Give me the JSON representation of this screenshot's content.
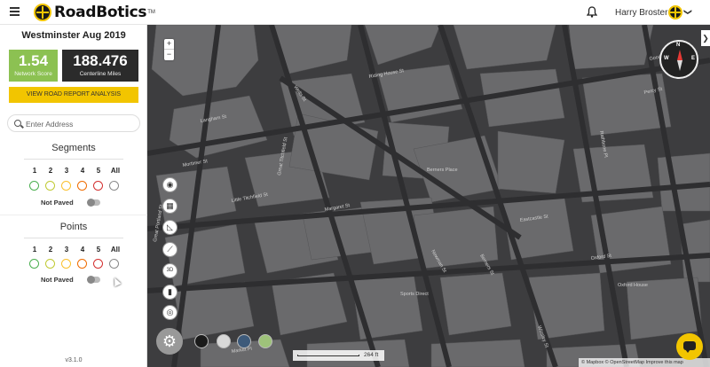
{
  "header": {
    "logo_text": "RoadBotics",
    "logo_tm": "TM",
    "user_name": "Harry Broster",
    "user_chevron": "❯"
  },
  "sidebar": {
    "project_title": "Westminster Aug 2019",
    "network_score": {
      "value": "1.54",
      "label": "Network Score",
      "color": "#8cc152"
    },
    "centerline": {
      "value": "188.476",
      "label": "Centerline Miles"
    },
    "report_button": "VIEW ROAD REPORT ANALYSIS",
    "search_placeholder": "Enter Address",
    "segments": {
      "title": "Segments",
      "ratings": [
        "1",
        "2",
        "3",
        "4",
        "5",
        "All"
      ],
      "rating_colors": [
        "#4caf50",
        "#c0ca33",
        "#fbc02d",
        "#ef6c00",
        "#d32f2f",
        "#888888"
      ],
      "not_paved_label": "Not Paved"
    },
    "points": {
      "title": "Points",
      "ratings": [
        "1",
        "2",
        "3",
        "4",
        "5",
        "All"
      ],
      "rating_colors": [
        "#4caf50",
        "#c0ca33",
        "#fbc02d",
        "#ef6c00",
        "#d32f2f",
        "#888888"
      ],
      "not_paved_label": "Not Paved"
    },
    "version": "v3.1.0"
  },
  "map": {
    "zoom_in": "+",
    "zoom_out": "−",
    "compass": {
      "n": "N",
      "w": "W",
      "e": "E"
    },
    "scale_label": "264 ft",
    "attribution": "© Mapbox © OpenStreetMap  Improve this map",
    "tools": [
      "camera-icon",
      "layers-icon",
      "measure-icon",
      "ruler-icon",
      "3d-icon",
      "trash-icon",
      "locate-icon"
    ],
    "tool_3d_label": "3D",
    "basemaps": [
      "dark",
      "streets",
      "satellite",
      "terrain"
    ],
    "street_labels": [
      "Wells St",
      "Mortimer St",
      "Little Titchfield St",
      "Great Titchfield St",
      "Margaret St",
      "Langham St",
      "Riding House St",
      "Oxford St",
      "Eastcastle St",
      "Berners St",
      "Newman St",
      "Rathbone Pl",
      "Winsley St",
      "Great Portland St",
      "Market Pl",
      "Percy St",
      "Goodge St",
      "Sports Direct",
      "Oxford House",
      "Berners Place"
    ]
  }
}
